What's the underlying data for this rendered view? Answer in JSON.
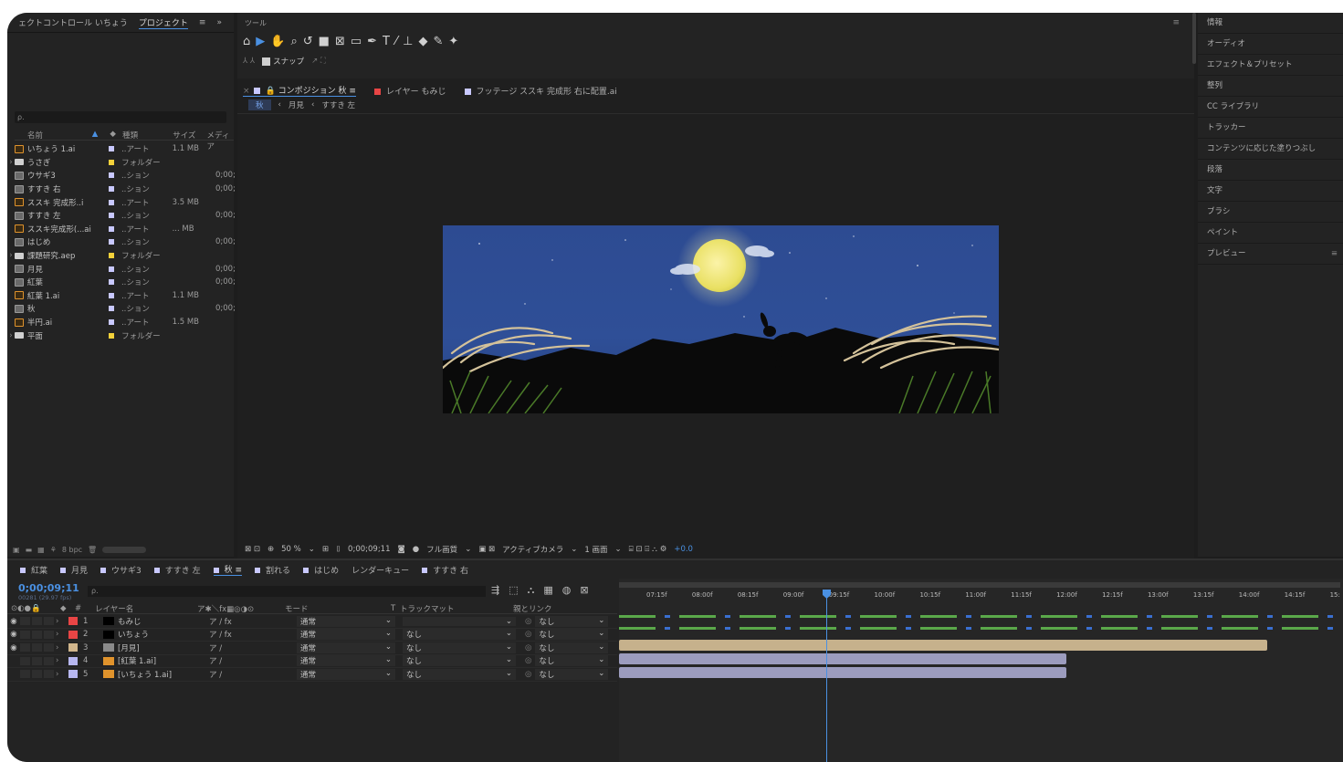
{
  "project_panel": {
    "tab_effects": "ェクトコントロール いちょう",
    "tab_project": "プロジェクト",
    "overflow": "»",
    "columns": [
      "名前",
      "種類",
      "サイズ",
      "メディア"
    ],
    "items": [
      {
        "twirl": "",
        "icon": "ai",
        "name": "いちょう 1.ai",
        "label": "#c8c8ff",
        "type": "..アート",
        "size": "1.1 MB",
        "media": ""
      },
      {
        "twirl": "›",
        "icon": "folder",
        "name": "うさぎ",
        "label": "#f3d13a",
        "type": "フォルダー",
        "size": "",
        "media": ""
      },
      {
        "twirl": "",
        "icon": "comp",
        "name": "ウサギ3",
        "label": "#c8c8ff",
        "type": "..ション",
        "size": "",
        "media": "0;00;"
      },
      {
        "twirl": "",
        "icon": "comp",
        "name": "すすき 右",
        "label": "#c8c8ff",
        "type": "..ション",
        "size": "",
        "media": "0;00;"
      },
      {
        "twirl": "",
        "icon": "ai",
        "name": "ススキ 完成形..i",
        "label": "#c8c8ff",
        "type": "..アート",
        "size": "3.5 MB",
        "media": ""
      },
      {
        "twirl": "",
        "icon": "comp",
        "name": "すすき 左",
        "label": "#c8c8ff",
        "type": "..ション",
        "size": "",
        "media": "0;00;"
      },
      {
        "twirl": "",
        "icon": "ai",
        "name": "ススキ完成形(...ai",
        "label": "#c8c8ff",
        "type": "..アート",
        "size": "... MB",
        "media": ""
      },
      {
        "twirl": "",
        "icon": "comp",
        "name": "はじめ",
        "label": "#c8c8ff",
        "type": "..ション",
        "size": "",
        "media": "0;00;"
      },
      {
        "twirl": "›",
        "icon": "folder",
        "name": "課題研究.aep",
        "label": "#f3d13a",
        "type": "フォルダー",
        "size": "",
        "media": ""
      },
      {
        "twirl": "",
        "icon": "comp",
        "name": "月見",
        "label": "#c8c8ff",
        "type": "..ション",
        "size": "",
        "media": "0;00;"
      },
      {
        "twirl": "",
        "icon": "comp",
        "name": "紅葉",
        "label": "#c8c8ff",
        "type": "..ション",
        "size": "",
        "media": "0;00;"
      },
      {
        "twirl": "",
        "icon": "ai",
        "name": "紅葉 1.ai",
        "label": "#c8c8ff",
        "type": "..アート",
        "size": "1.1 MB",
        "media": ""
      },
      {
        "twirl": "",
        "icon": "comp",
        "name": "秋",
        "label": "#c8c8ff",
        "type": "..ション",
        "size": "",
        "media": "0;00;"
      },
      {
        "twirl": "",
        "icon": "ai",
        "name": "半円.ai",
        "label": "#c8c8ff",
        "type": "..アート",
        "size": "1.5 MB",
        "media": ""
      },
      {
        "twirl": "›",
        "icon": "folder",
        "name": "平面",
        "label": "#f3d13a",
        "type": "フォルダー",
        "size": "",
        "media": ""
      }
    ],
    "footer_bpc": "8 bpc"
  },
  "tools": {
    "title": "ツール",
    "snap_label": "スナップ"
  },
  "viewer": {
    "tab_comp": "コンポジション 秋",
    "tab_layer": "レイヤー もみじ",
    "tab_footage": "フッテージ ススキ 完成形 右に配置.ai",
    "crumb_current": "秋",
    "crumb_2": "月見",
    "crumb_3": "すすき 左",
    "zoom": "50 %",
    "timecode": "0;00;09;11",
    "quality": "フル画質",
    "camera": "アクティブカメラ",
    "view": "1 画面",
    "exposure": "+0.0"
  },
  "right_panel": {
    "items": [
      "情報",
      "オーディオ",
      "エフェクト＆プリセット",
      "整列",
      "CC ライブラリ",
      "トラッカー",
      "コンテンツに応じた塗りつぶし",
      "段落",
      "文字",
      "ブラシ",
      "ペイント",
      "プレビュー"
    ]
  },
  "timeline": {
    "tabs": [
      {
        "label": "紅葉",
        "color": "#c8c8ff",
        "active": false
      },
      {
        "label": "月見",
        "color": "#c8c8ff",
        "active": false
      },
      {
        "label": "ウサギ3",
        "color": "#c8c8ff",
        "active": false
      },
      {
        "label": "すすき 左",
        "color": "#c8c8ff",
        "active": false
      },
      {
        "label": "秋",
        "color": "#c8c8ff",
        "active": true
      },
      {
        "label": "割れる",
        "color": "#c8c8ff",
        "active": false
      },
      {
        "label": "はじめ",
        "color": "#c8c8ff",
        "active": false
      },
      {
        "label": "レンダーキュー",
        "color": "",
        "active": false
      },
      {
        "label": "すすき 右",
        "color": "#c8c8ff",
        "active": false
      }
    ],
    "timecode": "0;00;09;11",
    "fps": "00281 (29.97 fps)",
    "search_placeholder": "ρ.",
    "headers": {
      "layer_name": "レイヤー名",
      "mode": "モード",
      "track_matte": "トラックマット",
      "parent": "親とリンク",
      "hash": "#",
      "t": "T"
    },
    "layers": [
      {
        "num": "1",
        "name": "もみじ",
        "label": "#e84545",
        "icon_color": "#000000",
        "switches": "ア / fx",
        "mode": "通常",
        "track": "",
        "parent": "なし"
      },
      {
        "num": "2",
        "name": "いちょう",
        "label": "#e84545",
        "icon_color": "#000000",
        "switches": "ア / fx",
        "mode": "通常",
        "track": "なし",
        "parent": "なし"
      },
      {
        "num": "3",
        "name": "[月見]",
        "label": "#d1b68c",
        "icon_color": "#8a8a8a",
        "switches": "ア /",
        "mode": "通常",
        "track": "なし",
        "parent": "なし"
      },
      {
        "num": "4",
        "name": "[紅葉 1.ai]",
        "label": "#b7b7f0",
        "icon_color": "#e0932c",
        "switches": "ア /",
        "mode": "通常",
        "track": "なし",
        "parent": "なし"
      },
      {
        "num": "5",
        "name": "[いちょう 1.ai]",
        "label": "#b7b7f0",
        "icon_color": "#e0932c",
        "switches": "ア /",
        "mode": "通常",
        "track": "なし",
        "parent": "なし"
      }
    ],
    "ruler_ticks": [
      "07:15f",
      "08:00f",
      "08:15f",
      "09:00f",
      "09:15f",
      "10:00f",
      "10:15f",
      "11:00f",
      "11:15f",
      "12:00f",
      "12:15f",
      "13:00f",
      "13:15f",
      "14:00f",
      "14:15f",
      "15:"
    ],
    "bar_colors": [
      "#5aa84a",
      "#5aa84a",
      "#c6b18c",
      "#9c9cbe",
      "#9c9cbe"
    ]
  }
}
